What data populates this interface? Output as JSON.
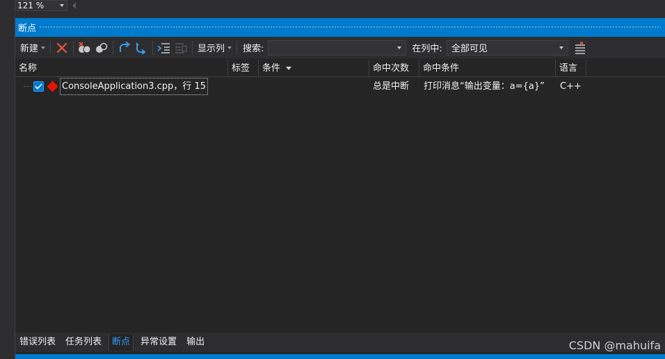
{
  "zoom": {
    "value": "121 %"
  },
  "panel": {
    "title": "断点"
  },
  "toolbar": {
    "new_label": "新建",
    "icons": [
      "delete-icon",
      "delete-all-icon",
      "disable-all-icon",
      "go-to-source-icon",
      "go-to-disassembly-icon",
      "import-icon",
      "export-icon"
    ],
    "columns_label": "显示列",
    "search_label": "搜索:",
    "search_value": "",
    "in_column_label": "在列中:",
    "in_column_value": "全部可见",
    "filter_icon": "reset-filter-icon"
  },
  "grid": {
    "columns": [
      "名称",
      "标签",
      "条件",
      "命中次数",
      "命中条件",
      "语言"
    ],
    "sorted_column": "条件",
    "rows": [
      {
        "checked": true,
        "name": "ConsoleApplication3.cpp，行 15",
        "label": "",
        "condition": "",
        "hit_count": "总是中断",
        "hit_condition": "打印消息“输出变量：a={a}”",
        "language": "C++"
      }
    ]
  },
  "bottom_tabs": [
    "错误列表",
    "任务列表",
    "断点",
    "异常设置",
    "输出"
  ],
  "active_tab": "断点",
  "watermark": "CSDN @mahuifa",
  "colors": {
    "accent": "#007acc",
    "breakpoint": "#e51400",
    "background": "#252526"
  }
}
